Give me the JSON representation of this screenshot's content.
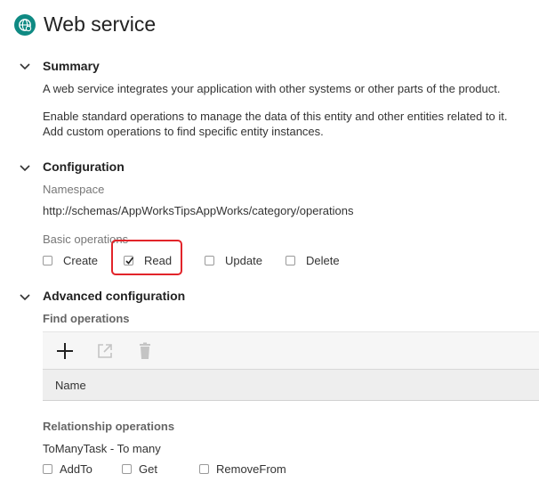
{
  "page": {
    "title": "Web service",
    "icon": "web-service-globe-icon",
    "accent": "#0f8a83"
  },
  "summary": {
    "heading": "Summary",
    "line1": "A web service integrates your application with other systems or other parts of the product.",
    "line2": "Enable standard operations to manage the data of this entity and other entities related to it.",
    "line3": "Add custom operations to find specific entity instances."
  },
  "configuration": {
    "heading": "Configuration",
    "namespace_label": "Namespace",
    "namespace_value": "http://schemas/AppWorksTipsAppWorks/category/operations",
    "basic_ops_label": "Basic operations",
    "operations": [
      {
        "label": "Create",
        "checked": false
      },
      {
        "label": "Read",
        "checked": true
      },
      {
        "label": "Update",
        "checked": false
      },
      {
        "label": "Delete",
        "checked": false
      }
    ],
    "highlight_color": "#e2242a"
  },
  "advanced": {
    "heading": "Advanced configuration",
    "find_ops_label": "Find operations",
    "toolbar": {
      "add_icon": "plus-icon",
      "open_icon": "open-external-icon",
      "delete_icon": "trash-icon"
    },
    "table_columns": [
      "Name"
    ],
    "relationship_label": "Relationship operations",
    "relationship_name": "ToManyTask - To many",
    "relationship_ops": [
      {
        "label": "AddTo",
        "checked": false
      },
      {
        "label": "Get",
        "checked": false
      },
      {
        "label": "RemoveFrom",
        "checked": false
      }
    ]
  }
}
